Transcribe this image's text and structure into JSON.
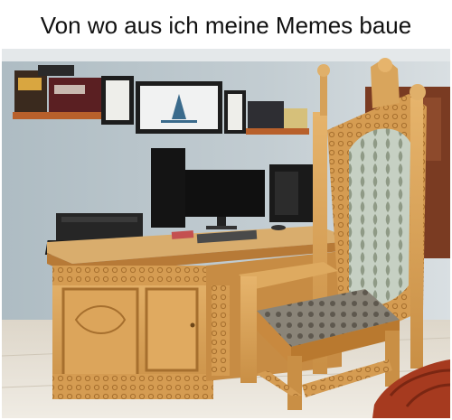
{
  "caption": "Von wo aus ich meine Memes baue",
  "colors": {
    "wall": "#b7c3c9",
    "wood": "#d9a35c",
    "fabric": "#c9d3c6",
    "floor": "#e8e3d9"
  }
}
